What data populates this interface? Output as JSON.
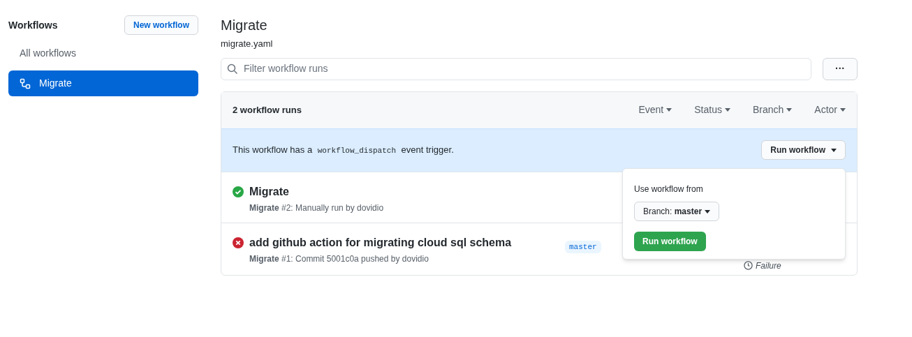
{
  "sidebar": {
    "title": "Workflows",
    "new_button": "New workflow",
    "items": [
      {
        "label": "All workflows",
        "selected": false,
        "icon": false
      },
      {
        "label": "Migrate",
        "selected": true,
        "icon": true
      }
    ]
  },
  "header": {
    "title": "Migrate",
    "file": "migrate.yaml"
  },
  "search": {
    "placeholder": "Filter workflow runs"
  },
  "more_button": "···",
  "runs_header": {
    "count": "2 workflow runs",
    "filters": [
      "Event",
      "Status",
      "Branch",
      "Actor"
    ]
  },
  "dispatch": {
    "text_before": "This workflow has a",
    "code": "workflow_dispatch",
    "text_after": "event trigger.",
    "button": "Run workflow"
  },
  "runs": [
    {
      "title": "Migrate",
      "kind": "success",
      "meta": "**Migrate** #2: Manually run by dovidio"
    },
    {
      "title": "add github action for migrating cloud sql schema",
      "kind": "failure",
      "meta": "**Migrate** #1: Commit 5001c0a pushed by dovidio",
      "branch": "master",
      "result": "Failure"
    }
  ],
  "popup": {
    "label": "Use workflow from",
    "branch": "Branch: **master**",
    "button": "Run workflow"
  }
}
